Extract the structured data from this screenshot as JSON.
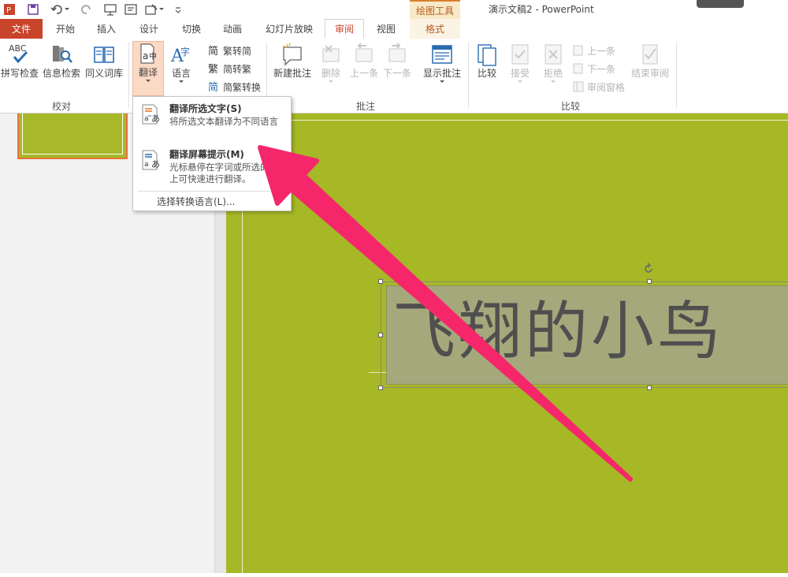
{
  "window": {
    "app_title": "演示文稿2 - PowerPoint",
    "context_tab_group": "绘图工具"
  },
  "tabs": [
    {
      "label": "文件"
    },
    {
      "label": "开始"
    },
    {
      "label": "插入"
    },
    {
      "label": "设计"
    },
    {
      "label": "切换"
    },
    {
      "label": "动画"
    },
    {
      "label": "幻灯片放映"
    },
    {
      "label": "审阅"
    },
    {
      "label": "视图"
    },
    {
      "label": "格式"
    }
  ],
  "ribbon": {
    "proofing": {
      "group_label": "校对",
      "spelling_label": "拼写检查",
      "research_label": "信息检索",
      "thesaurus_label": "同义词库",
      "abc_text": "ABC"
    },
    "language": {
      "translate_label": "翻译",
      "language_label": "语言",
      "to_simplified": "繁转简",
      "to_traditional": "简转繁",
      "convert": "简繁转换",
      "icon_fan": "繁",
      "icon_jian": "简",
      "icon_zi": "字"
    },
    "comments": {
      "group_label": "批注",
      "new_comment": "新建批注",
      "delete": "删除",
      "previous": "上一条",
      "next": "下一条",
      "show_comments": "显示批注"
    },
    "compare": {
      "group_label": "比较",
      "compare": "比较",
      "accept": "接受",
      "reject": "拒绝",
      "previous": "上一条",
      "next": "下一条",
      "reviewing_pane": "审阅窗格",
      "end_review": "结束审阅"
    }
  },
  "translate_menu": {
    "item1_title": "翻译所选文字(S)",
    "item1_desc": "将所选文本翻译为不同语言",
    "item2_title": "翻译屏幕提示(M)",
    "item2_desc": "光标悬停在字词或所选的段落上可快速进行翻译。",
    "choose_language": "选择转换语言(L)..."
  },
  "slide": {
    "title_text": "飞翔的小鸟"
  },
  "colors": {
    "accent": "#c8442a",
    "slide_bg": "#a6b826",
    "arrow": "#f5276a"
  }
}
